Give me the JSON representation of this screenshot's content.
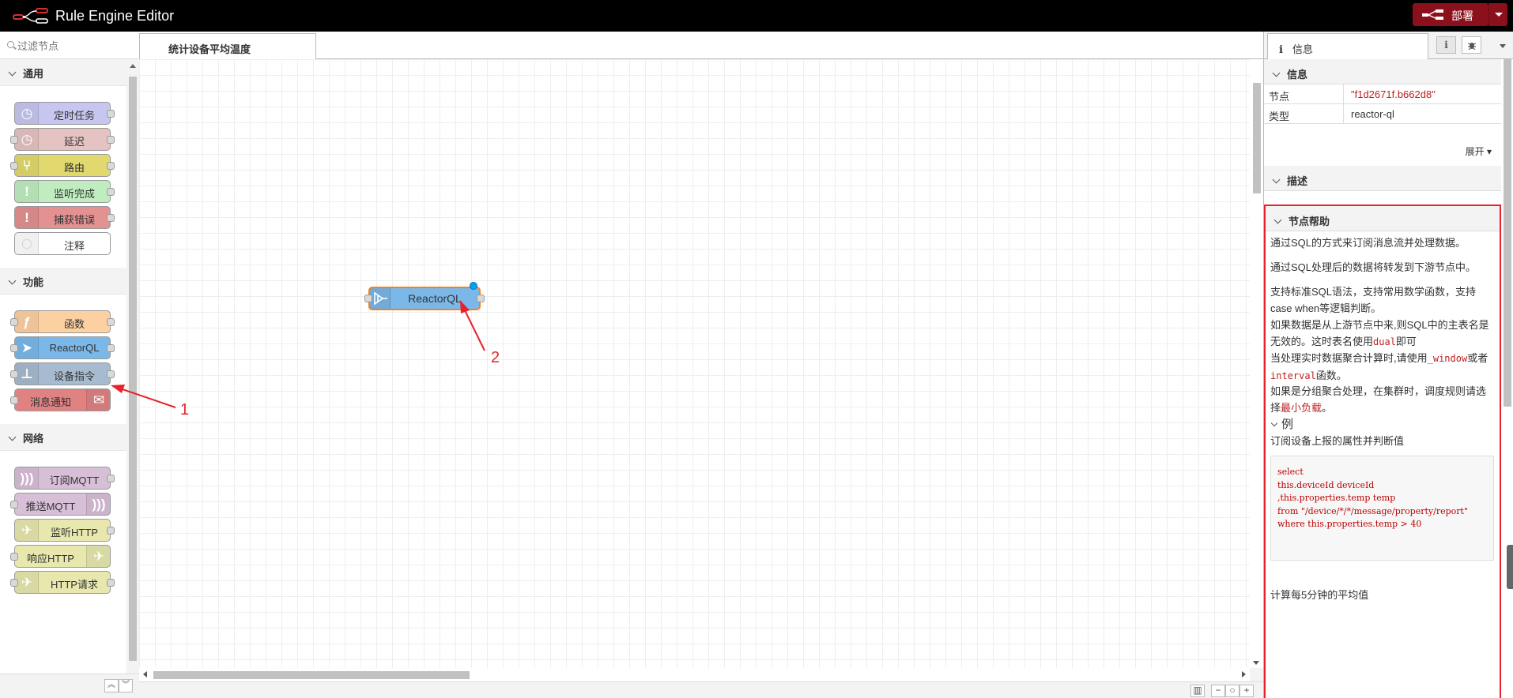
{
  "app": {
    "title": "Rule Engine Editor",
    "deploy_label": "部署"
  },
  "palette": {
    "search_placeholder": "过滤节点",
    "categories": [
      {
        "label": "通用",
        "nodes": [
          {
            "label": "定时任务",
            "icon": "timer-icon",
            "color": "#c7c6f0",
            "icon_side": "left",
            "ports": "out"
          },
          {
            "label": "延迟",
            "icon": "clock-icon",
            "color": "#e6c3c3",
            "icon_side": "left",
            "ports": "both"
          },
          {
            "label": "路由",
            "icon": "route-icon",
            "color": "#e2d96e",
            "icon_side": "left",
            "ports": "both"
          },
          {
            "label": "监听完成",
            "icon": "exclamation-icon",
            "color": "#c0edc0",
            "icon_side": "left",
            "ports": "out"
          },
          {
            "label": "捕获错误",
            "icon": "exclamation-icon",
            "color": "#e49191",
            "icon_side": "left",
            "ports": "out"
          },
          {
            "label": "注释",
            "icon": "comment-icon",
            "color": "#ffffff",
            "icon_side": "left",
            "ports": "none"
          }
        ]
      },
      {
        "label": "功能",
        "nodes": [
          {
            "label": "函数",
            "icon": "function-icon",
            "color": "#fdd0a2",
            "icon_side": "left",
            "ports": "both"
          },
          {
            "label": "ReactorQL",
            "icon": "reactor-icon",
            "color": "#7bb8ea",
            "icon_side": "left",
            "ports": "both"
          },
          {
            "label": "设备指令",
            "icon": "device-icon",
            "color": "#a6bbcf",
            "icon_side": "left",
            "ports": "both"
          },
          {
            "label": "消息通知",
            "icon": "mail-icon",
            "color": "#e08282",
            "icon_side": "right",
            "ports": "in"
          }
        ]
      },
      {
        "label": "网络",
        "nodes": [
          {
            "label": "订阅MQTT",
            "icon": "broadcast-icon",
            "color": "#d8bfd8",
            "icon_side": "left",
            "ports": "out"
          },
          {
            "label": "推送MQTT",
            "icon": "broadcast-icon",
            "color": "#d8bfd8",
            "icon_side": "right",
            "ports": "in"
          },
          {
            "label": "监听HTTP",
            "icon": "globe-icon",
            "color": "#e7e7ae",
            "icon_side": "left",
            "ports": "out"
          },
          {
            "label": "响应HTTP",
            "icon": "globe-icon",
            "color": "#e7e7ae",
            "icon_side": "right",
            "ports": "in"
          },
          {
            "label": "HTTP请求",
            "icon": "globe-icon",
            "color": "#e7e7ae",
            "icon_side": "left",
            "ports": "both"
          }
        ]
      }
    ]
  },
  "workspace": {
    "tab_label": "统计设备平均温度",
    "node_label": "ReactorQL",
    "annotations": [
      "1",
      "2"
    ]
  },
  "sidebar": {
    "tab_label": "信息",
    "info_header": "信息",
    "props": [
      {
        "key": "节点",
        "value": "\"f1d2671f.b662d8\""
      },
      {
        "key": "类型",
        "value": "reactor-ql"
      }
    ],
    "expand_label": "展开",
    "desc_header": "描述",
    "help": {
      "header": "节点帮助",
      "p1": "通过SQL的方式来订阅消息流并处理数据。",
      "p2": "通过SQL处理后的数据将转发到下游节点中。",
      "p3": "支持标准SQL语法，支持常用数学函数，支持case when等逻辑判断。",
      "p4a": "如果数据是从上游节点中来,则SQL中的主表名是无效的。这时表名使用",
      "p4code": "dual",
      "p4b": "即可",
      "p5a": "当处理实时数据聚合计算时,请使用",
      "p5code1": "_window",
      "p5b": "或者",
      "p5code2": "interval",
      "p5c": "函数。",
      "p6a": "如果是分组聚合处理，在集群时，调度规则请选择",
      "p6b": "最小负载",
      "p6c": "。",
      "example_header": "例",
      "example_desc": "订阅设备上报的属性并判断值",
      "code": "select\nthis.deviceId deviceId\n,this.properties.temp temp\nfrom \"/device/*/*/message/property/report\"\nwhere this.properties.temp > 40",
      "tail": "计算每5分钟的平均值"
    }
  }
}
